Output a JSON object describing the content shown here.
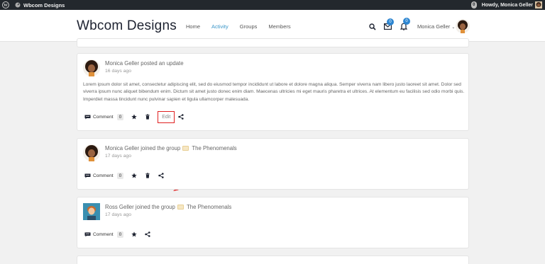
{
  "adminbar": {
    "site_name": "Wbcom Designs",
    "howdy": "Howdy, Monica Geller",
    "notif_count": "0"
  },
  "header": {
    "logo": "Wbcom Designs",
    "nav": [
      "Home",
      "Activity",
      "Groups",
      "Members"
    ],
    "active_nav": "Activity",
    "messages_count": "0",
    "notifications_count": "0",
    "user_name": "Monica Geller"
  },
  "activities": [
    {
      "author": "Monica Geller",
      "action": "posted an update",
      "time": "16 days ago",
      "content": "Lorem ipsum dolor sit amet, consectetur adipiscing elit, sed do eiusmod tempor incididunt ut labore et dolore magna aliqua. Semper viverra nam libero justo laoreet sit amet. Dolor sed viverra ipsum nunc aliquet bibendum enim. Dictum sit amet justo donec enim diam. Maecenas ultricies mi eget mauris pharetra et ultrices. At elementum eu facilisis sed odio morbi quis. Imperdiet massa tincidunt nunc pulvinar sapien et ligula ullamcorper malesuada.",
      "comment_label": "Comment",
      "comment_count": "0",
      "edit_label": "Edit"
    },
    {
      "author": "Monica Geller",
      "action": "joined the group",
      "group": "The Phenomenals",
      "time": "17 days ago",
      "comment_label": "Comment",
      "comment_count": "0"
    },
    {
      "author": "Ross Geller",
      "action": "joined the group",
      "group": "The Phenomenals",
      "time": "17 days ago",
      "comment_label": "Comment",
      "comment_count": "0"
    }
  ],
  "colors": {
    "accent": "#3c97c9",
    "badge": "#2e86d1",
    "highlight": "#e02020",
    "adminbar": "#23282d"
  }
}
